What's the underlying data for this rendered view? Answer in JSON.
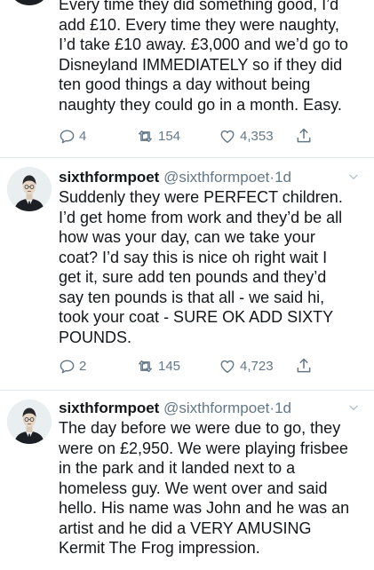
{
  "tweets": [
    {
      "partial": true,
      "lines": [
        "Every time they did something good, I’d",
        "add £10. Every time they were naughty,",
        "I’d take £10 away. £3,000 and we’d go to",
        "Disneyland IMMEDIATELY so if they did",
        "ten good things a day without being",
        "naughty they could go in a month. Easy."
      ],
      "replies": "4",
      "retweets": "154",
      "likes": "4,353"
    },
    {
      "author": "sixthformpoet",
      "handle": "@sixthformpoet",
      "separator": "·",
      "time": "1d",
      "lines": [
        "Suddenly they were PERFECT children.",
        "I’d get home from work and they’d be all",
        "how was your day, can we take your",
        "coat? I’d say this is nice oh right wait I",
        "get it, sure add ten pounds and they’d",
        "say ten pounds is that all - we said hi,",
        "took your coat - SURE OK ADD SIXTY",
        "POUNDS."
      ],
      "replies": "2",
      "retweets": "145",
      "likes": "4,723"
    },
    {
      "author": "sixthformpoet",
      "handle": "@sixthformpoet",
      "separator": "·",
      "time": "1d",
      "lines": [
        "The day before we were due to go, they",
        "were on £2,950. We were playing frisbee",
        "in the park and it landed next to a",
        "homeless guy. We went over and said",
        "hello. His name was John and he was an",
        "artist and he did a VERY AMUSING",
        "Kermit The Frog impression."
      ]
    }
  ],
  "colors": {
    "text": "#14171a",
    "muted": "#657786",
    "divider": "#e1e8ed"
  },
  "icons": [
    "reply-icon",
    "retweet-icon",
    "like-icon",
    "share-icon",
    "chevron-down-icon"
  ]
}
